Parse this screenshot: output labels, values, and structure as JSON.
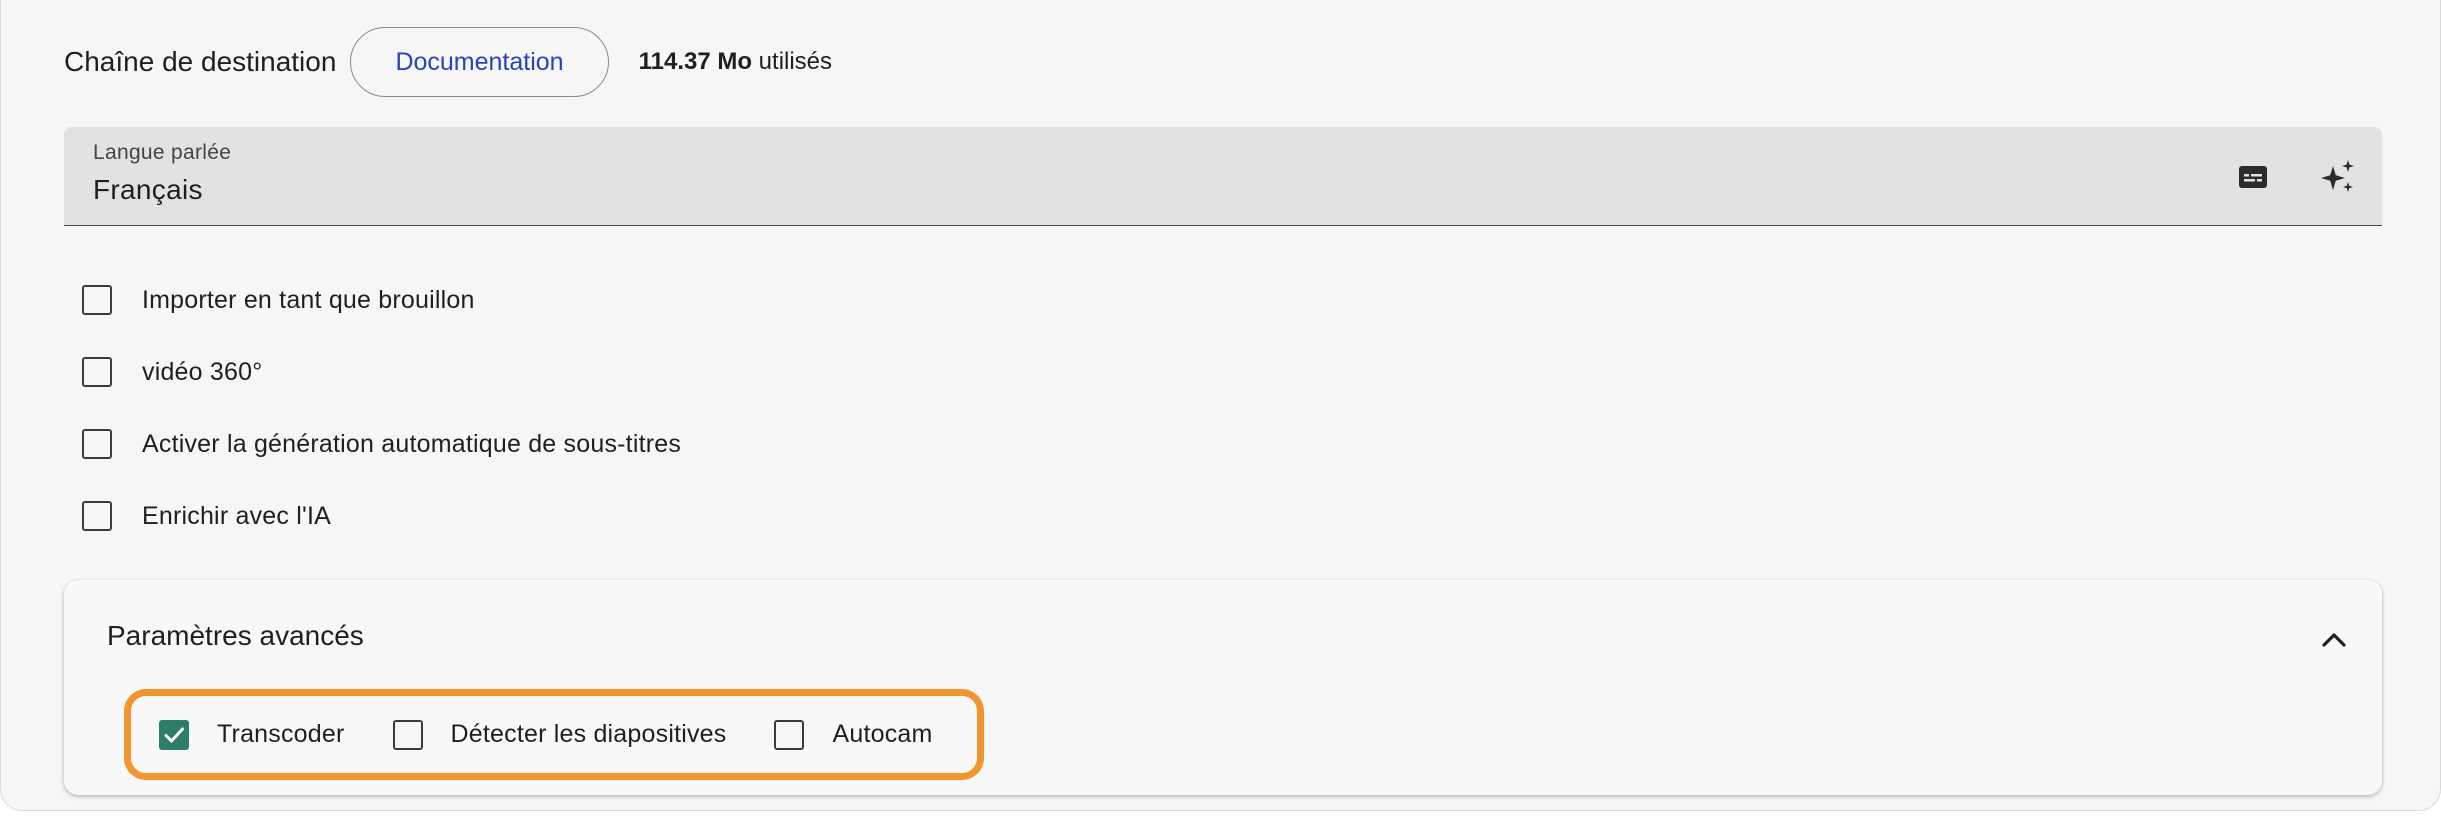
{
  "header": {
    "destination_label": "Chaîne de destination",
    "documentation_button": "Documentation",
    "usage_value": "114.37 Mo",
    "usage_suffix": "utilisés"
  },
  "language_field": {
    "label": "Langue parlée",
    "value": "Français",
    "icons": [
      "subtitles-icon",
      "sparkle-icon"
    ]
  },
  "options": [
    {
      "label": "Importer en tant que brouillon",
      "checked": false
    },
    {
      "label": "vidéo 360°",
      "checked": false
    },
    {
      "label": "Activer la génération automatique de sous-titres",
      "checked": false
    },
    {
      "label": "Enrichir avec l'IA",
      "checked": false
    }
  ],
  "advanced": {
    "title": "Paramètres avancés",
    "expanded": true,
    "options": [
      {
        "label": "Transcoder",
        "checked": true
      },
      {
        "label": "Détecter les diapositives",
        "checked": false
      },
      {
        "label": "Autocam",
        "checked": false
      }
    ]
  },
  "colors": {
    "checked": "#2e7d67",
    "highlight_border": "#f0952f",
    "link": "#2743b8"
  }
}
